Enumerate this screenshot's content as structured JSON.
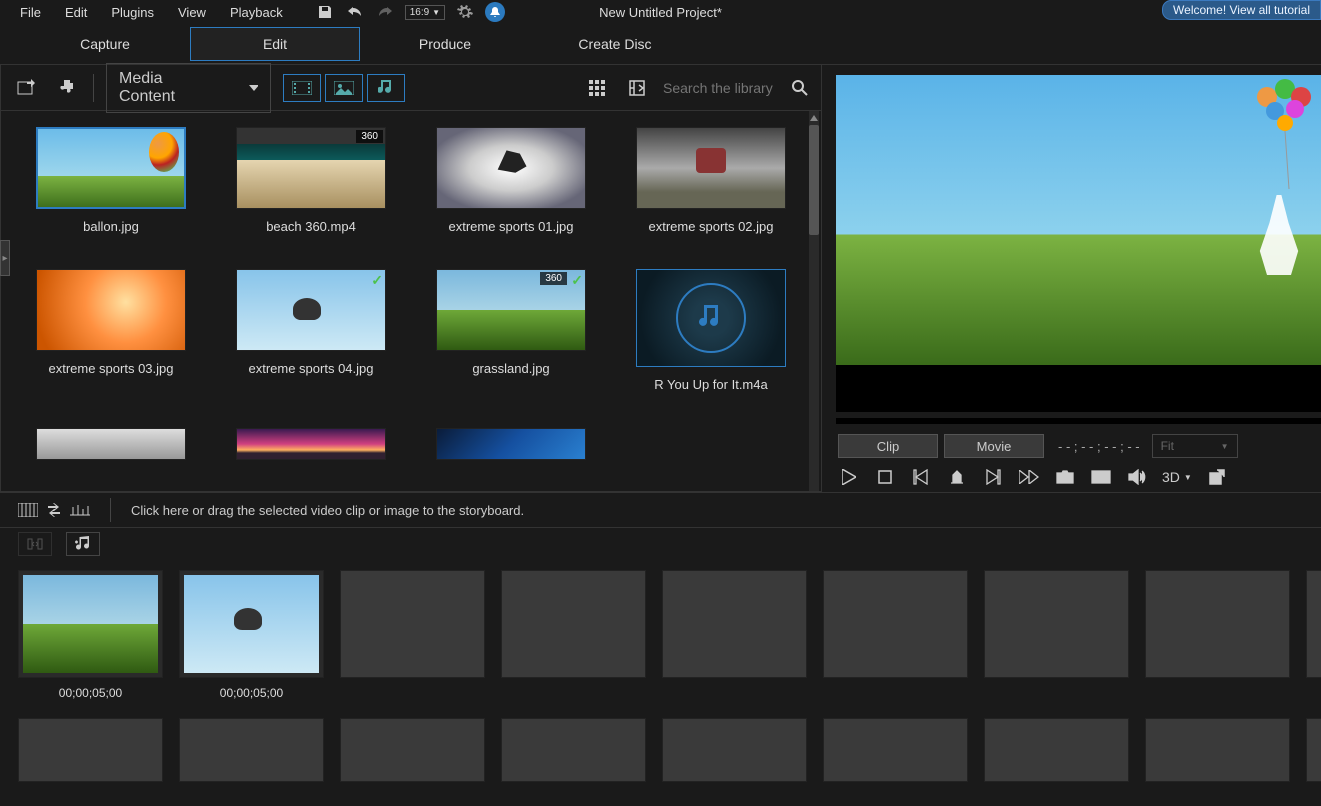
{
  "menu": {
    "file": "File",
    "edit": "Edit",
    "plugins": "Plugins",
    "view": "View",
    "playback": "Playback"
  },
  "aspect_ratio": "16:9",
  "project_title": "New Untitled Project*",
  "tutorial_link": "Welcome! View all tutorial",
  "mode_tabs": {
    "capture": "Capture",
    "edit": "Edit",
    "produce": "Produce",
    "create_disc": "Create Disc"
  },
  "library": {
    "dropdown": "Media Content",
    "search_placeholder": "Search the library",
    "items": [
      {
        "label": "ballon.jpg",
        "selected": true,
        "badge": null,
        "checked": false,
        "skin": "sky-balloon"
      },
      {
        "label": "beach 360.mp4",
        "selected": false,
        "badge": "360",
        "checked": false,
        "skin": "beach360"
      },
      {
        "label": "extreme sports 01.jpg",
        "selected": false,
        "badge": null,
        "checked": false,
        "skin": "bmx"
      },
      {
        "label": "extreme sports 02.jpg",
        "selected": false,
        "badge": null,
        "checked": false,
        "skin": "moto"
      },
      {
        "label": "extreme sports 03.jpg",
        "selected": false,
        "badge": null,
        "checked": false,
        "skin": "skate"
      },
      {
        "label": "extreme sports 04.jpg",
        "selected": false,
        "badge": null,
        "checked": true,
        "skin": "skydive"
      },
      {
        "label": "grassland.jpg",
        "selected": false,
        "badge": "360",
        "checked": true,
        "skin": "grass"
      },
      {
        "label": "R You Up for It.m4a",
        "selected": false,
        "badge": null,
        "checked": false,
        "skin": "audio"
      }
    ],
    "partial_items": [
      {
        "skin": "walker"
      },
      {
        "skin": "sunset"
      },
      {
        "skin": "bluewash"
      }
    ]
  },
  "preview": {
    "clip_tab": "Clip",
    "movie_tab": "Movie",
    "timecode": "- - ; - - ; - - ; - -",
    "fit": "Fit",
    "d3d": "3D"
  },
  "storyboard": {
    "hint": "Click here or drag the selected video clip or image to the storyboard.",
    "clips": [
      {
        "time": "00;00;05;00",
        "skin": "grass"
      },
      {
        "time": "00;00;05;00",
        "skin": "skydive"
      }
    ],
    "empty_slots_row1": 7,
    "empty_slots_row2": 9
  }
}
